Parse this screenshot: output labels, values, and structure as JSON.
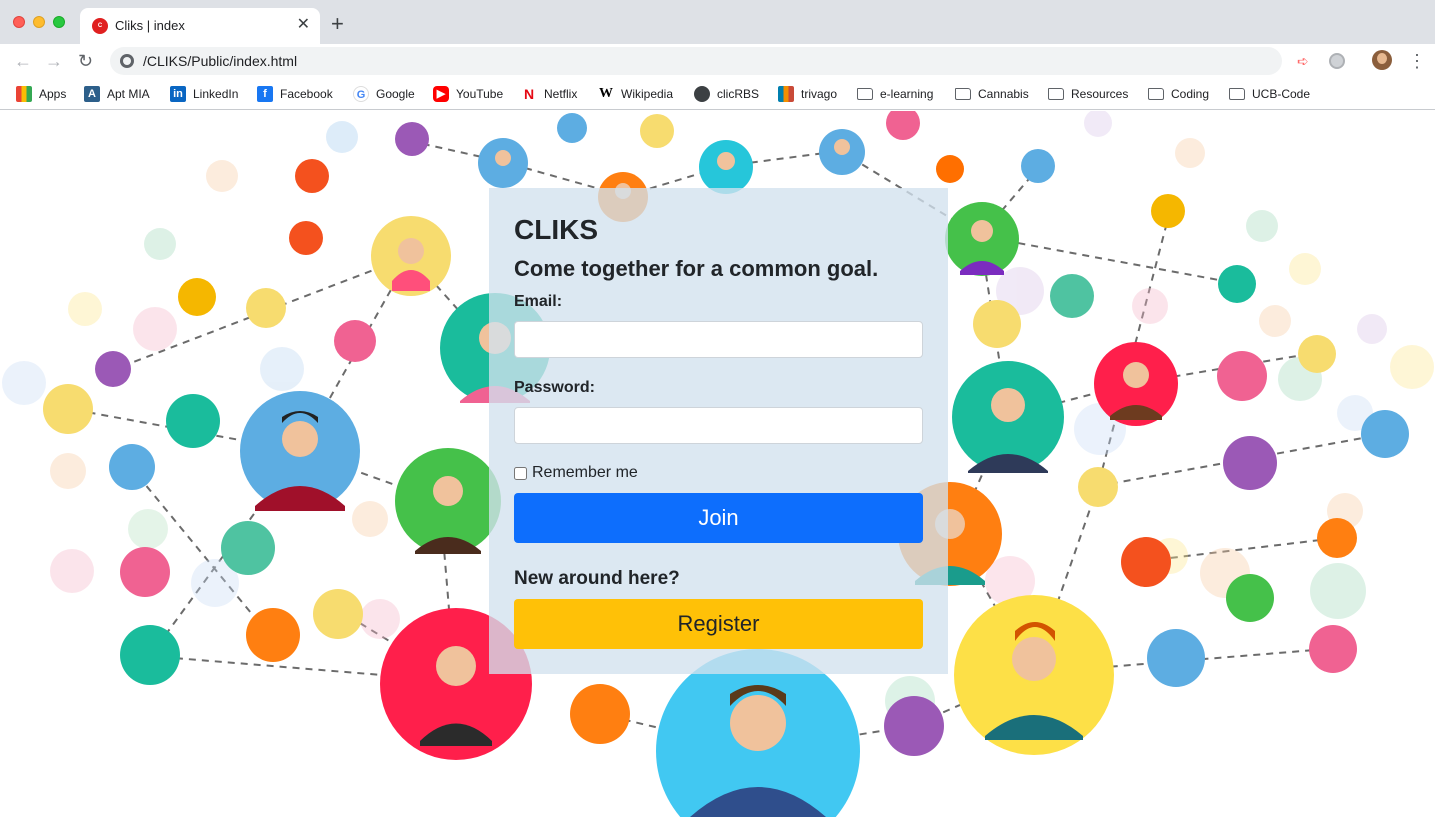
{
  "browser": {
    "tab_title": "Cliks | index",
    "tab_close": "✕",
    "new_tab": "+",
    "url": "/CLIKS/Public/index.html"
  },
  "bookmarks": [
    {
      "label": "Apps",
      "icon": "apps-grid-icon"
    },
    {
      "label": "Apt MIA",
      "icon": "apt-mia-icon"
    },
    {
      "label": "LinkedIn",
      "icon": "linkedin-icon"
    },
    {
      "label": "Facebook",
      "icon": "facebook-icon"
    },
    {
      "label": "Google",
      "icon": "google-icon"
    },
    {
      "label": "YouTube",
      "icon": "youtube-icon"
    },
    {
      "label": "Netflix",
      "icon": "netflix-icon"
    },
    {
      "label": "Wikipedia",
      "icon": "wikipedia-icon"
    },
    {
      "label": "clicRBS",
      "icon": "globe-icon"
    },
    {
      "label": "trivago",
      "icon": "trivago-icon"
    },
    {
      "label": "e-learning",
      "icon": "folder-icon"
    },
    {
      "label": "Cannabis",
      "icon": "folder-icon"
    },
    {
      "label": "Resources",
      "icon": "folder-icon"
    },
    {
      "label": "Coding",
      "icon": "folder-icon"
    },
    {
      "label": "UCB-Code",
      "icon": "folder-icon"
    }
  ],
  "login": {
    "brand": "CLIKS",
    "tagline": "Come together for a common goal.",
    "email_label": "Email:",
    "email_value": "",
    "password_label": "Password:",
    "password_value": "",
    "remember_label": "Remember me",
    "remember_checked": false,
    "join_label": "Join",
    "new_around": "New around here?",
    "register_label": "Register"
  },
  "colors": {
    "join_button": "#0d6efd",
    "register_button": "#ffc107",
    "panel_overlay": "#d2e1ee"
  }
}
